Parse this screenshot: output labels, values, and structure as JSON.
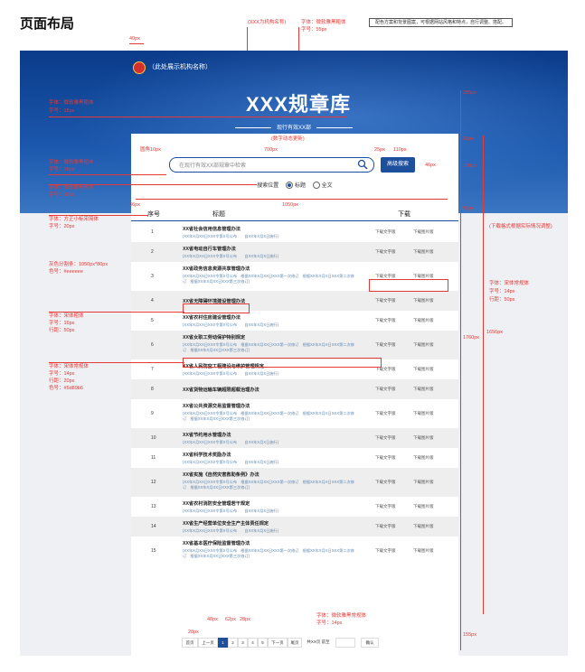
{
  "page_heading": "页面布局",
  "top_notes": {
    "org_var": "(XXX为机构名称)",
    "font_title": "字体：微软雅黑粗体",
    "size_title": "字号：55px",
    "color_note": "配色方案和背景图案，可根据网站风格和特点，自行调整、搭配。"
  },
  "dims": {
    "d40": "40px",
    "d285": "285px",
    "d36": "36px",
    "d180": "180px",
    "d90": "90px",
    "d1760": "1760px",
    "d1656": "1656px",
    "d155": "155px",
    "d700": "700px",
    "d25": "25px",
    "d110": "110px",
    "d46": "46px",
    "d36b": "36px",
    "d1050": "1050px",
    "d28a": "28px",
    "d48": "48px",
    "d62": "62px",
    "d28b": "28px",
    "radius": "圆角10px",
    "live_update": "(数字动态更新)",
    "dl_note": "(下载格式根据实际情况调整)"
  },
  "left_notes": {
    "n1a": "字体：微软雅黑粗体",
    "n1b": "字号：18px",
    "n2a": "字体：微软雅黑粗体",
    "n2b": "字号：18px",
    "n3a": "字体：微软雅黑粗体",
    "n3b": "字号：16px",
    "n4a": "字体：方正小标宋简体",
    "n4b": "字号：20px",
    "n5a": "灰色分割条：1050px*80px",
    "n5b": "色号：#eeeeee",
    "n6a": "字体：宋体粗体",
    "n6b": "字号：16px",
    "n6c": "行距：50px",
    "n7a": "字体：宋体常规体",
    "n7b": "字号：14px",
    "n7c": "行距：20px",
    "n7d": "色号：#5d89b6"
  },
  "right_notes": {
    "a": "字体：宋体常规体",
    "b": "字号：14px",
    "c": "行距：50px"
  },
  "bottom_notes": {
    "a": "字体：微软雅黑常规体",
    "b": "字号：14px"
  },
  "header": {
    "org_name": "（此处展示机构名称）",
    "library_title": "XXX规章库",
    "subtitle": "现行有效XX部"
  },
  "search": {
    "placeholder": "在现行有效XX部规章中检索",
    "advanced_label": "高级搜索",
    "position_label": "搜索位置",
    "opt_title": "标题",
    "opt_full": "全文"
  },
  "table": {
    "col_no": "序号",
    "col_title": "标题",
    "col_download": "下载",
    "dl_text": "下载文字版",
    "dl_image": "下载图片版",
    "rows": [
      {
        "no": "1",
        "name": "XX省社会信用信息管理办法",
        "meta": "(XX年X月XX日XXX令第X号公布　　自XX年X月X日施行)"
      },
      {
        "no": "2",
        "name": "XX省电动自行车管理办法",
        "meta": "(XX年X月XX日XXX令第X号公布　　自XX年X月X日施行)"
      },
      {
        "no": "3",
        "name": "XX省政务信息资源共享管理办法",
        "meta": "(XX年X月XX日XXX令第X号公布　根据XX年X月XX日XXX第一次修订　根据XX年X月X日XXX第二次修订　根据XX年X月XX日XXX第三次修订)"
      },
      {
        "no": "4",
        "name": "XX省无障碍环境建设管理办法",
        "meta": ""
      },
      {
        "no": "5",
        "name": "XX省农村住房建设管理办法",
        "meta": "(XX年X月XX日XXX令第X号公布　　自XX年X月X日施行)"
      },
      {
        "no": "6",
        "name": "XX省女职工劳动保护特别规定",
        "meta": "(XX年X月XX日XXX令第X号公布　根据XX年X月XX日XXX第一次修订　根据XX年X月X日XXX第二次修订　根据XX年X月XX日XXX第三次修订)"
      },
      {
        "no": "7",
        "name": "XX省人民防空工程建设与维护管理规定",
        "meta": "(XX年X月XX日XXX令第X号公布　　自XX年X月X日施行)"
      },
      {
        "no": "8",
        "name": "XX省货物运输车辆超限超载治理办法",
        "meta": ""
      },
      {
        "no": "9",
        "name": "XX省公共资源交易监督管理办法",
        "meta": "(XX年X月XX日XXX令第X号公布　根据XX年X月XX日XXX第一次修订　根据XX年X月X日XXX第二次修订　根据XX年X月XX日XXX第三次修订)"
      },
      {
        "no": "10",
        "name": "XX省节约用水管理办法",
        "meta": "(XX年X月XX日XXX令第X号公布　　自XX年X月X日施行)"
      },
      {
        "no": "11",
        "name": "XX省科学技术奖励办法",
        "meta": "(XX年X月XX日XXX令第X号公布　　自XX年X月X日施行)"
      },
      {
        "no": "12",
        "name": "XX省实施《自然灾害救助条例》办法",
        "meta": "(XX年X月XX日XXX令第X号公布　根据XX年X月XX日XXX第一次修订　根据XX年X月X日XXX第二次修订　根据XX年X月XX日XXX第三次修订)"
      },
      {
        "no": "13",
        "name": "XX省农村消防安全管理若干规定",
        "meta": "(XX年X月XX日XXX令第X号公布　　自XX年X月X日施行)"
      },
      {
        "no": "14",
        "name": "XX省生产经营单位安全生产主体责任规定",
        "meta": "(XX年X月XX日XXX令第X号公布　　自XX年X月X日施行)"
      },
      {
        "no": "15",
        "name": "XX省基本医疗保险监督管理办法",
        "meta": "(XX年X月XX日XXX令第X号公布　根据XX年X月XX日XXX第一次修订　根据XX年X月X日XXX第二次修订　根据XX年X月XX日XXX第三次修订)"
      }
    ]
  },
  "pager": {
    "first": "首页",
    "prev": "上一页",
    "p1": "1",
    "p2": "2",
    "p3": "3",
    "p4": "4",
    "p5": "5",
    "next": "下一页",
    "last": "尾页",
    "total": "共XX页 前至",
    "go": "确认"
  },
  "colors": {
    "accent": "#1c4f9c",
    "meta": "#5d89b6",
    "annotation": "#e53935",
    "stripe": "#eeeeee"
  }
}
